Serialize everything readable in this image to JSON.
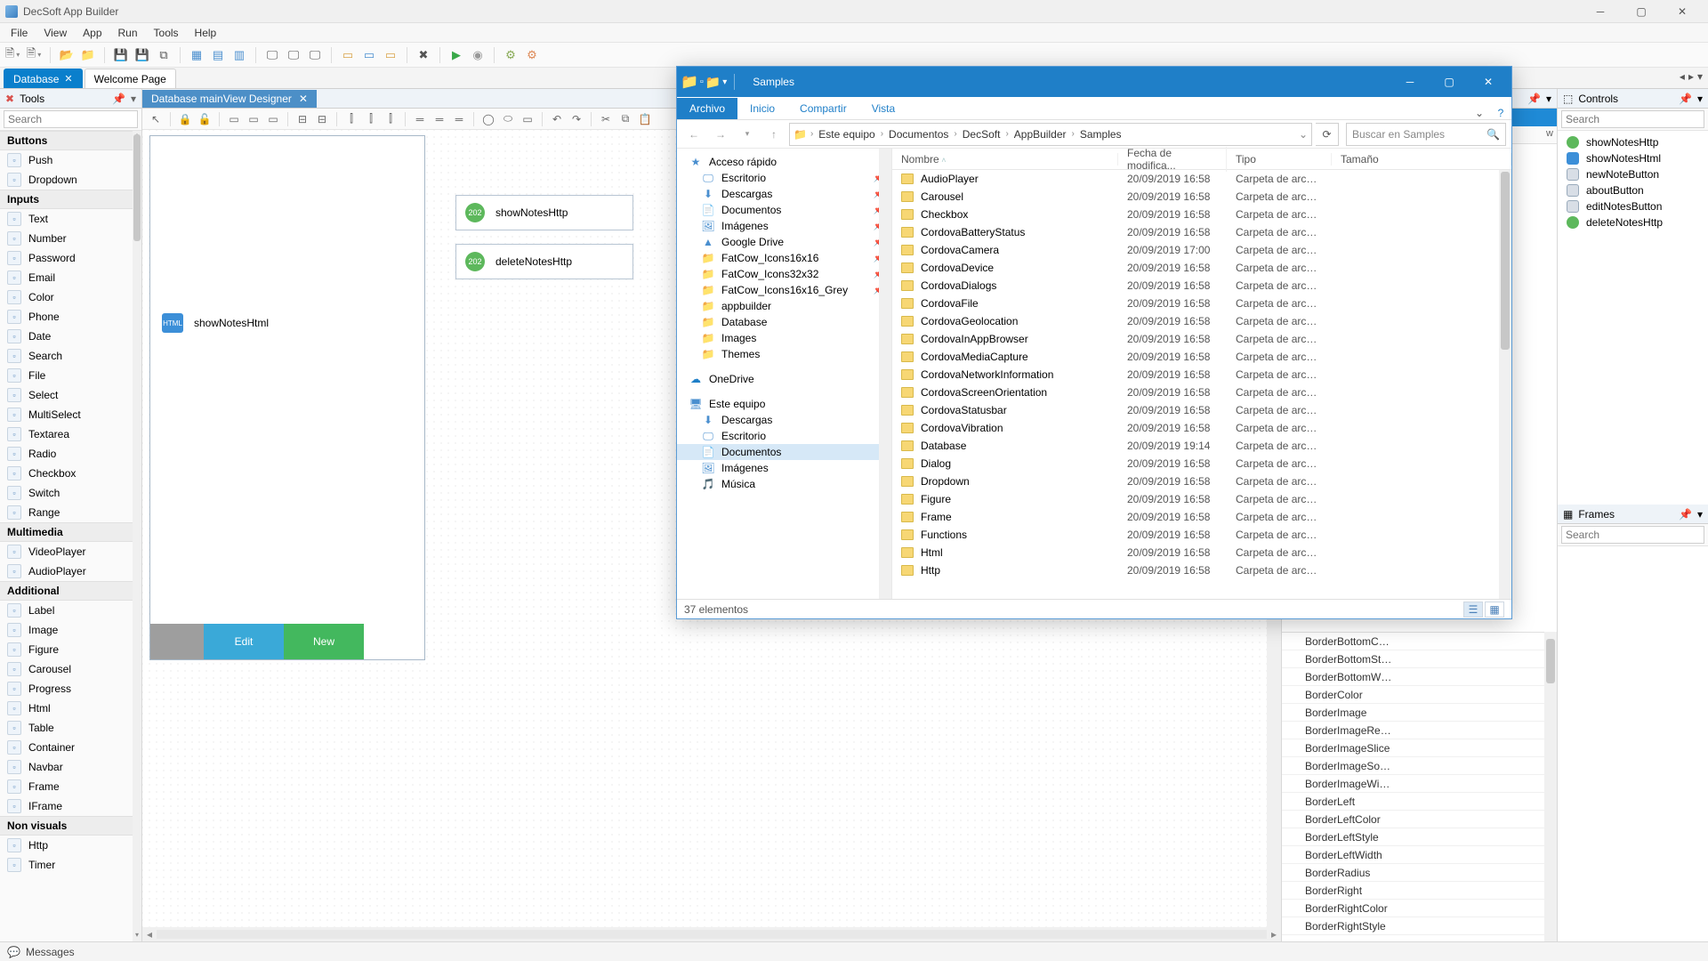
{
  "app": {
    "title": "DecSoft App Builder",
    "menu": [
      "File",
      "View",
      "App",
      "Run",
      "Tools",
      "Help"
    ],
    "doc_tabs": {
      "db": "Database",
      "welcome": "Welcome Page"
    },
    "status": "Messages"
  },
  "tools_panel": {
    "title": "Tools",
    "search_placeholder": "Search",
    "categories": [
      {
        "name": "Buttons",
        "items": [
          "Push",
          "Dropdown"
        ]
      },
      {
        "name": "Inputs",
        "items": [
          "Text",
          "Number",
          "Password",
          "Email",
          "Color",
          "Phone",
          "Date",
          "Search",
          "File",
          "Select",
          "MultiSelect",
          "Textarea",
          "Radio",
          "Checkbox",
          "Switch",
          "Range"
        ]
      },
      {
        "name": "Multimedia",
        "items": [
          "VideoPlayer",
          "AudioPlayer"
        ]
      },
      {
        "name": "Additional",
        "items": [
          "Label",
          "Image",
          "Figure",
          "Carousel",
          "Progress",
          "Html",
          "Table",
          "Container",
          "Navbar",
          "Frame",
          "IFrame"
        ]
      },
      {
        "name": "Non visuals",
        "items": [
          "Http",
          "Timer"
        ]
      }
    ]
  },
  "designer": {
    "tab_title": "Database mainView Designer",
    "components": {
      "http1": "showNotesHttp",
      "http1_badge": "202",
      "http2": "deleteNotesHttp",
      "http2_badge": "202",
      "html1": "showNotesHtml",
      "html1_badge": "HTML",
      "btn_edit": "Edit",
      "btn_new": "New"
    }
  },
  "props_panel": {
    "nav_suffix": "w",
    "items": [
      "BorderBottomC…",
      "BorderBottomSt…",
      "BorderBottomW…",
      "BorderColor",
      "BorderImage",
      "BorderImageRe…",
      "BorderImageSlice",
      "BorderImageSo…",
      "BorderImageWi…",
      "BorderLeft",
      "BorderLeftColor",
      "BorderLeftStyle",
      "BorderLeftWidth",
      "BorderRadius",
      "BorderRight",
      "BorderRightColor",
      "BorderRightStyle"
    ]
  },
  "controls_panel": {
    "title": "Controls",
    "search_placeholder": "Search",
    "items": [
      {
        "name": "showNotesHttp",
        "kind": "http"
      },
      {
        "name": "showNotesHtml",
        "kind": "html"
      },
      {
        "name": "newNoteButton",
        "kind": "btn"
      },
      {
        "name": "aboutButton",
        "kind": "btn"
      },
      {
        "name": "editNotesButton",
        "kind": "btn"
      },
      {
        "name": "deleteNotesHttp",
        "kind": "http"
      }
    ]
  },
  "frames_panel": {
    "title": "Frames",
    "search_placeholder": "Search"
  },
  "explorer": {
    "title": "Samples",
    "ribbon": {
      "file": "Archivo",
      "home": "Inicio",
      "share": "Compartir",
      "view": "Vista"
    },
    "breadcrumbs": [
      "Este equipo",
      "Documentos",
      "DecSoft",
      "AppBuilder",
      "Samples"
    ],
    "search_placeholder": "Buscar en Samples",
    "nav": {
      "quick": "Acceso rápido",
      "quick_items": [
        "Escritorio",
        "Descargas",
        "Documentos",
        "Imágenes",
        "Google Drive",
        "FatCow_Icons16x16",
        "FatCow_Icons32x32",
        "FatCow_Icons16x16_Grey",
        "appbuilder",
        "Database",
        "Images",
        "Themes"
      ],
      "onedrive": "OneDrive",
      "thispc": "Este equipo",
      "thispc_items": [
        "Descargas",
        "Escritorio",
        "Documentos",
        "Imágenes",
        "Música"
      ]
    },
    "columns": {
      "name": "Nombre",
      "date": "Fecha de modifica...",
      "type": "Tipo",
      "size": "Tamaño"
    },
    "type_folder": "Carpeta de archivos",
    "items": [
      {
        "n": "AudioPlayer",
        "d": "20/09/2019 16:58"
      },
      {
        "n": "Carousel",
        "d": "20/09/2019 16:58"
      },
      {
        "n": "Checkbox",
        "d": "20/09/2019 16:58"
      },
      {
        "n": "CordovaBatteryStatus",
        "d": "20/09/2019 16:58"
      },
      {
        "n": "CordovaCamera",
        "d": "20/09/2019 17:00"
      },
      {
        "n": "CordovaDevice",
        "d": "20/09/2019 16:58"
      },
      {
        "n": "CordovaDialogs",
        "d": "20/09/2019 16:58"
      },
      {
        "n": "CordovaFile",
        "d": "20/09/2019 16:58"
      },
      {
        "n": "CordovaGeolocation",
        "d": "20/09/2019 16:58"
      },
      {
        "n": "CordovaInAppBrowser",
        "d": "20/09/2019 16:58"
      },
      {
        "n": "CordovaMediaCapture",
        "d": "20/09/2019 16:58"
      },
      {
        "n": "CordovaNetworkInformation",
        "d": "20/09/2019 16:58"
      },
      {
        "n": "CordovaScreenOrientation",
        "d": "20/09/2019 16:58"
      },
      {
        "n": "CordovaStatusbar",
        "d": "20/09/2019 16:58"
      },
      {
        "n": "CordovaVibration",
        "d": "20/09/2019 16:58"
      },
      {
        "n": "Database",
        "d": "20/09/2019 19:14"
      },
      {
        "n": "Dialog",
        "d": "20/09/2019 16:58"
      },
      {
        "n": "Dropdown",
        "d": "20/09/2019 16:58"
      },
      {
        "n": "Figure",
        "d": "20/09/2019 16:58"
      },
      {
        "n": "Frame",
        "d": "20/09/2019 16:58"
      },
      {
        "n": "Functions",
        "d": "20/09/2019 16:58"
      },
      {
        "n": "Html",
        "d": "20/09/2019 16:58"
      },
      {
        "n": "Http",
        "d": "20/09/2019 16:58"
      }
    ],
    "status": "37 elementos"
  }
}
